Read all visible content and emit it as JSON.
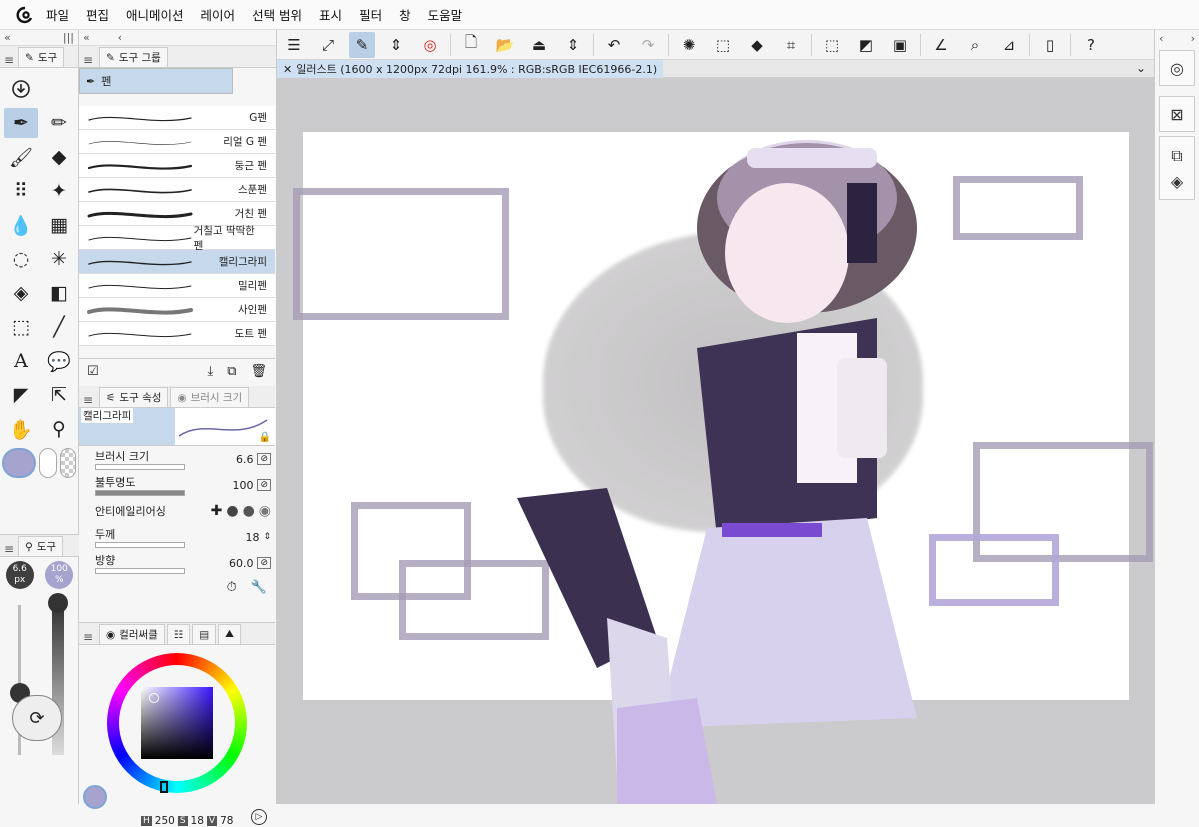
{
  "menu": {
    "items": [
      "파일",
      "편집",
      "애니메이션",
      "레이어",
      "선택 범위",
      "표시",
      "필터",
      "창",
      "도움말"
    ]
  },
  "tool_panel": {
    "tab": "도구"
  },
  "subtool_group": {
    "tab": "도구 그룹",
    "group_name": "펜",
    "brushes": [
      "G펜",
      "리얼 G 펜",
      "둥근 펜",
      "스푼펜",
      "거친 펜",
      "거칠고 딱딱한 펜",
      "캘리그라피",
      "밀리펜",
      "사인펜",
      "도트 펜"
    ],
    "selected_index": 6
  },
  "tool_property": {
    "tab1": "도구 속성",
    "tab2": "브러시 크기",
    "preview_label": "캘리그라피",
    "brush_size_label": "브러시 크기",
    "brush_size": "6.6",
    "opacity_label": "불투명도",
    "opacity": "100",
    "antialias_label": "안티에일리어싱",
    "thickness_label": "두께",
    "thickness": "18",
    "direction_label": "방향",
    "direction": "60.0"
  },
  "size_panel": {
    "tab": "도구",
    "size_value": "6.6",
    "size_unit": "px",
    "opacity_value": "100",
    "opacity_unit": "%"
  },
  "color_panel": {
    "tab": "컬러써클",
    "h_label": "H",
    "h": "250",
    "s_label": "S",
    "s": "18",
    "v_label": "V",
    "v": "78",
    "main_color": "#a7a3cf"
  },
  "document": {
    "title": "일러스트 (1600 x 1200px 72dpi 161.9% : RGB:sRGB IEC61966-2.1)"
  },
  "colors": {
    "accent": "#b8cfe6",
    "canvas_bg": "#cbcacd"
  }
}
